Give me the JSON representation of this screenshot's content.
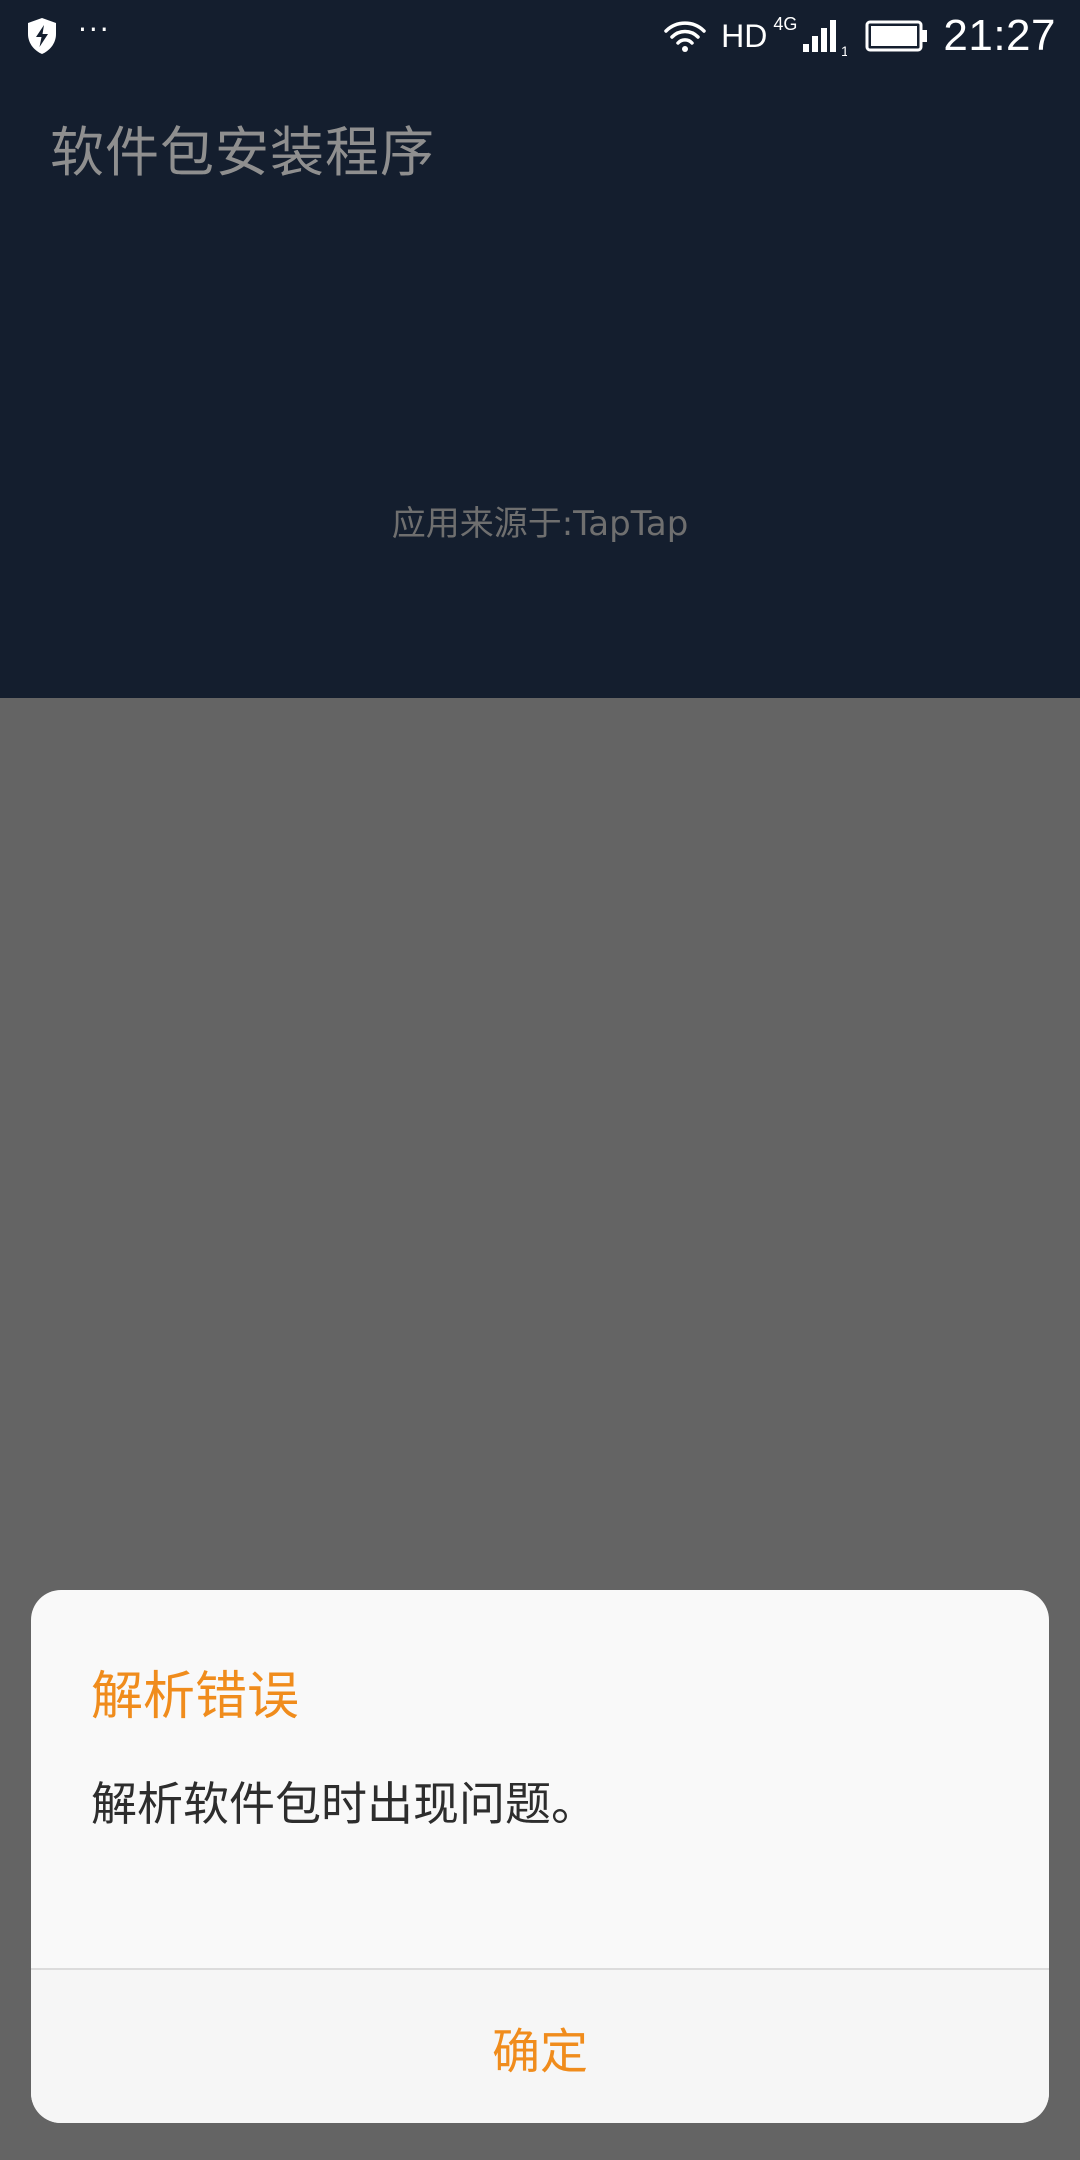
{
  "status_bar": {
    "time": "21:27",
    "network_type": "HD",
    "network_gen": "4G",
    "sim_slot": "1",
    "notification_overflow": "···",
    "icons": [
      "shield-bolt-icon",
      "wifi-icon",
      "signal-icon",
      "battery-icon"
    ]
  },
  "installer": {
    "title": "软件包安装程序",
    "source": "应用来源于:TapTap"
  },
  "dialog": {
    "title": "解析错误",
    "message": "解析软件包时出现问题。",
    "ok_label": "确定"
  },
  "colors": {
    "accent": "#f08c1c",
    "header_bg": "#141e2e",
    "scrim_bg": "#646464",
    "dialog_bg": "#f9f9f9"
  }
}
